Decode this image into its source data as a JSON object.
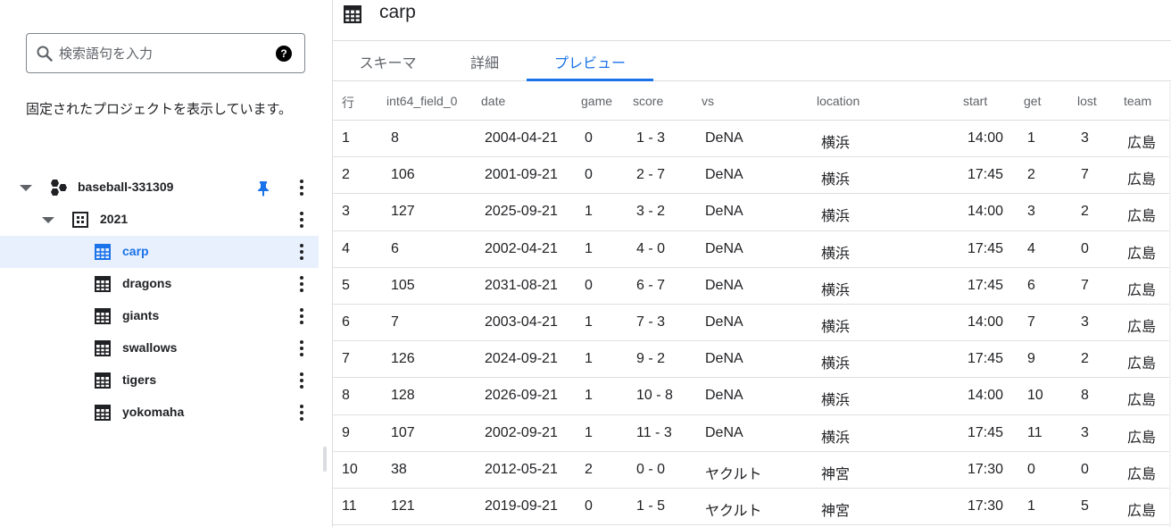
{
  "search": {
    "placeholder": "検索語句を入力",
    "help_glyph": "?"
  },
  "pinned_message": "固定されたプロジェクトを表示しています。",
  "tree": {
    "project": {
      "label": "baseball-331309"
    },
    "dataset": {
      "label": "2021"
    },
    "tables": [
      {
        "label": "carp",
        "selected": true
      },
      {
        "label": "dragons"
      },
      {
        "label": "giants"
      },
      {
        "label": "swallows"
      },
      {
        "label": "tigers"
      },
      {
        "label": "yokomaha"
      }
    ]
  },
  "header": {
    "title": "carp"
  },
  "tabs": [
    {
      "label": "スキーマ"
    },
    {
      "label": "詳細"
    },
    {
      "label": "プレビュー",
      "active": true
    }
  ],
  "table": {
    "columns": [
      "行",
      "int64_field_0",
      "date",
      "game",
      "score",
      "vs",
      "location",
      "start",
      "get",
      "lost",
      "team"
    ],
    "rows": [
      [
        "1",
        "8",
        "2004-04-21",
        "0",
        "1 - 3",
        "DeNA",
        "横浜",
        "14:00",
        "1",
        "3",
        "広島"
      ],
      [
        "2",
        "106",
        "2001-09-21",
        "0",
        "2 - 7",
        "DeNA",
        "横浜",
        "17:45",
        "2",
        "7",
        "広島"
      ],
      [
        "3",
        "127",
        "2025-09-21",
        "1",
        "3 - 2",
        "DeNA",
        "横浜",
        "14:00",
        "3",
        "2",
        "広島"
      ],
      [
        "4",
        "6",
        "2002-04-21",
        "1",
        "4 - 0",
        "DeNA",
        "横浜",
        "17:45",
        "4",
        "0",
        "広島"
      ],
      [
        "5",
        "105",
        "2031-08-21",
        "0",
        "6 - 7",
        "DeNA",
        "横浜",
        "17:45",
        "6",
        "7",
        "広島"
      ],
      [
        "6",
        "7",
        "2003-04-21",
        "1",
        "7 - 3",
        "DeNA",
        "横浜",
        "14:00",
        "7",
        "3",
        "広島"
      ],
      [
        "7",
        "126",
        "2024-09-21",
        "1",
        "9 - 2",
        "DeNA",
        "横浜",
        "17:45",
        "9",
        "2",
        "広島"
      ],
      [
        "8",
        "128",
        "2026-09-21",
        "1",
        "10 - 8",
        "DeNA",
        "横浜",
        "14:00",
        "10",
        "8",
        "広島"
      ],
      [
        "9",
        "107",
        "2002-09-21",
        "1",
        "11 - 3",
        "DeNA",
        "横浜",
        "17:45",
        "11",
        "3",
        "広島"
      ],
      [
        "10",
        "38",
        "2012-05-21",
        "2",
        "0 - 0",
        "ヤクルト",
        "神宮",
        "17:30",
        "0",
        "0",
        "広島"
      ],
      [
        "11",
        "121",
        "2019-09-21",
        "0",
        "1 - 5",
        "ヤクルト",
        "神宮",
        "17:30",
        "1",
        "5",
        "広島"
      ]
    ]
  },
  "colors": {
    "accent": "#1a73e8",
    "selected_bg": "#e8f0fe",
    "border": "#dadce0"
  }
}
